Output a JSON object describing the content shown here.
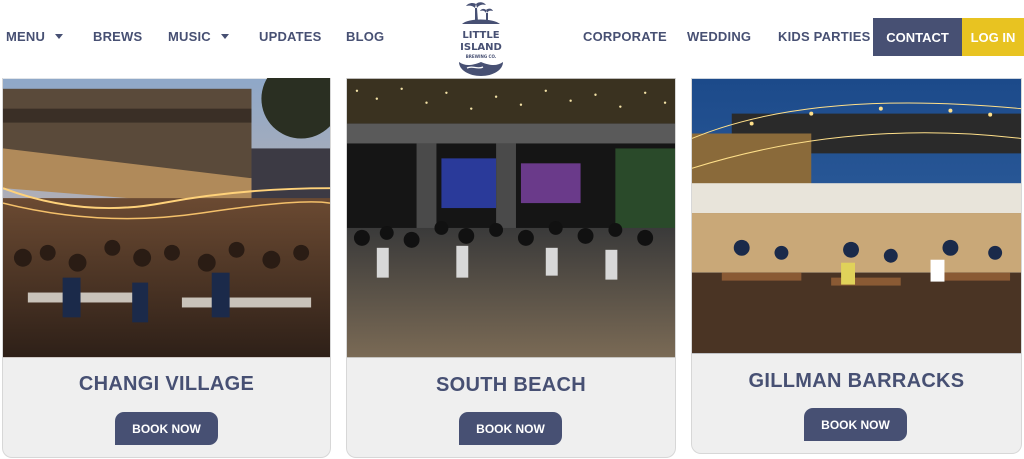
{
  "nav": {
    "left_items": [
      {
        "label": "MENU"
      },
      {
        "label": "BREWS"
      },
      {
        "label": "MUSIC"
      },
      {
        "label": "UPDATES"
      },
      {
        "label": "BLOG"
      }
    ],
    "right_items": [
      {
        "label": "CORPORATE"
      },
      {
        "label": "WEDDING"
      },
      {
        "label": "KIDS PARTIES"
      }
    ],
    "contact_label": "CONTACT",
    "login_label": "LOG IN",
    "logo": {
      "line1": "LITTLE",
      "line2": "ISLAND",
      "line3": "BREWING CO."
    }
  },
  "colors": {
    "brand_navy": "#475073",
    "login_yellow": "#e8c321",
    "card_bg": "#efefef"
  },
  "locations": [
    {
      "name": "CHANGI VILLAGE",
      "button_label": "BOOK NOW"
    },
    {
      "name": "SOUTH BEACH",
      "button_label": "BOOK NOW"
    },
    {
      "name": "GILLMAN BARRACKS",
      "button_label": "BOOK NOW"
    }
  ]
}
